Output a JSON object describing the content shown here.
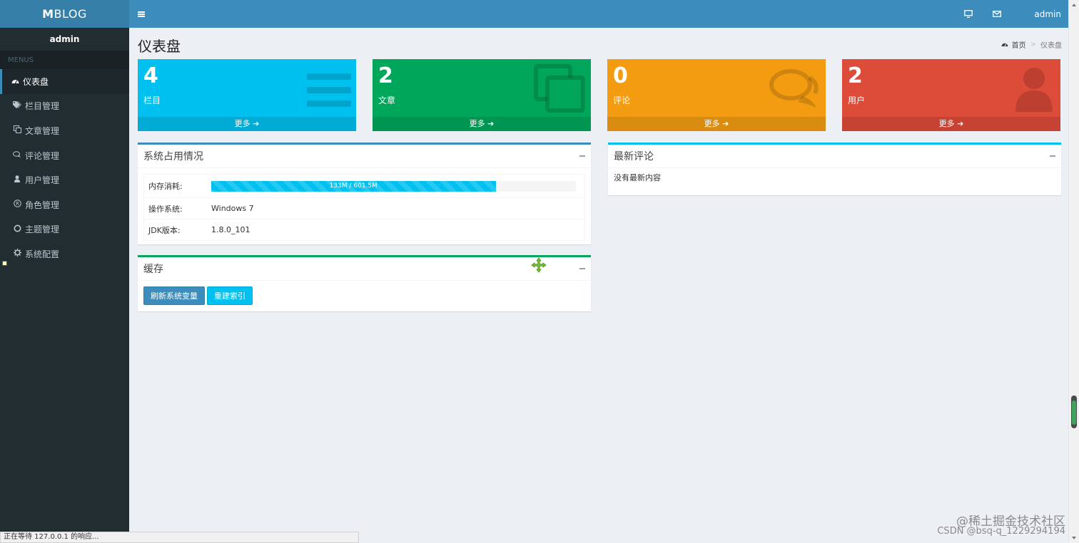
{
  "brand": {
    "bold": "M",
    "rest": "BLOG"
  },
  "sidebar": {
    "user": "admin",
    "menu_header": "MENUS",
    "items": [
      {
        "label": "仪表盘",
        "icon": "dashboard-icon",
        "active": true
      },
      {
        "label": "栏目管理",
        "icon": "tags-icon"
      },
      {
        "label": "文章管理",
        "icon": "copy-icon"
      },
      {
        "label": "评论管理",
        "icon": "comments-icon"
      },
      {
        "label": "用户管理",
        "icon": "user-icon"
      },
      {
        "label": "角色管理",
        "icon": "registered-icon"
      },
      {
        "label": "主题管理",
        "icon": "circle-icon"
      },
      {
        "label": "系统配置",
        "icon": "gear-icon"
      }
    ]
  },
  "header": {
    "user": "admin",
    "icons": [
      "monitor-icon",
      "envelope-icon"
    ]
  },
  "page": {
    "title": "仪表盘",
    "breadcrumb": {
      "home": "首页",
      "current": "仪表盘"
    }
  },
  "stats": [
    {
      "value": "4",
      "label": "栏目",
      "more": "更多",
      "color": "#00c0ef",
      "icon": "bars-icon"
    },
    {
      "value": "2",
      "label": "文章",
      "more": "更多",
      "color": "#00a65a",
      "icon": "copy-icon"
    },
    {
      "value": "0",
      "label": "评论",
      "more": "更多",
      "color": "#f39c12",
      "icon": "comments-icon"
    },
    {
      "value": "2",
      "label": "用户",
      "more": "更多",
      "color": "#dd4b39",
      "icon": "user-icon"
    }
  ],
  "system_box": {
    "title": "系统占用情况",
    "memory_label": "内存消耗:",
    "memory_text": "133M / 601.5M",
    "memory_fraction": 0.78,
    "os_label": "操作系统:",
    "os_value": "Windows 7",
    "jdk_label": "JDK版本:",
    "jdk_value": "1.8.0_101"
  },
  "cache_box": {
    "title": "缓存",
    "refresh_button": "刷新系统变量",
    "reindex_button": "重建索引"
  },
  "comments_box": {
    "title": "最新评论",
    "empty_text": "没有最新内容"
  },
  "status_bar": "正在等待 127.0.0.1 的响应...",
  "watermark": {
    "line1": "@稀土掘金技术社区",
    "line2": "CSDN @bsq-q_1229294194"
  }
}
